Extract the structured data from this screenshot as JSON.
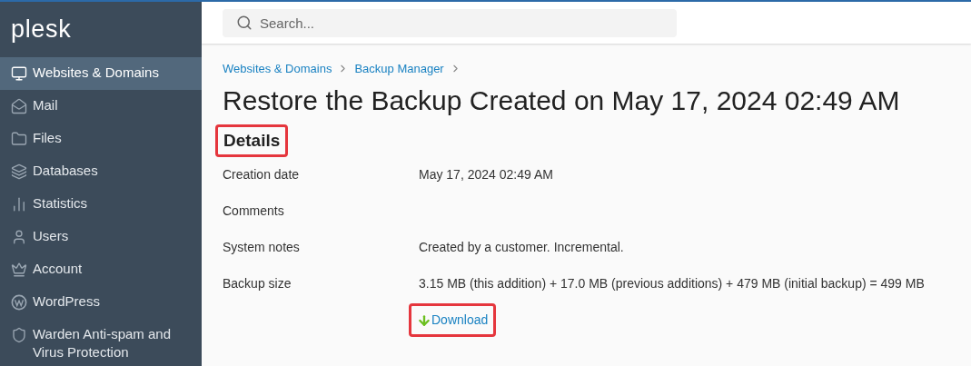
{
  "sidebar": {
    "logo": "plesk",
    "items": [
      {
        "label": "Websites & Domains",
        "selected": true
      },
      {
        "label": "Mail",
        "selected": false
      },
      {
        "label": "Files",
        "selected": false
      },
      {
        "label": "Databases",
        "selected": false
      },
      {
        "label": "Statistics",
        "selected": false
      },
      {
        "label": "Users",
        "selected": false
      },
      {
        "label": "Account",
        "selected": false
      },
      {
        "label": "WordPress",
        "selected": false
      },
      {
        "label": "Warden Anti-spam and Virus Protection",
        "selected": false
      }
    ]
  },
  "search": {
    "placeholder": "Search..."
  },
  "breadcrumbs": [
    "Websites & Domains",
    "Backup Manager"
  ],
  "title": "Restore the Backup Created on May 17, 2024 02:49 AM",
  "section": {
    "heading": "Details",
    "highlighted": true
  },
  "details": [
    {
      "label": "Creation date",
      "value": "May 17, 2024 02:49 AM"
    },
    {
      "label": "Comments"
    },
    {
      "label": "System notes",
      "value": "Created by a customer. Incremental."
    },
    {
      "label": "Backup size",
      "value": "3.15 MB (this addition) + 17.0 MB (previous additions) + 479 MB (initial backup) = 499 MB"
    }
  ],
  "download": {
    "label": "Download",
    "highlighted": true
  }
}
